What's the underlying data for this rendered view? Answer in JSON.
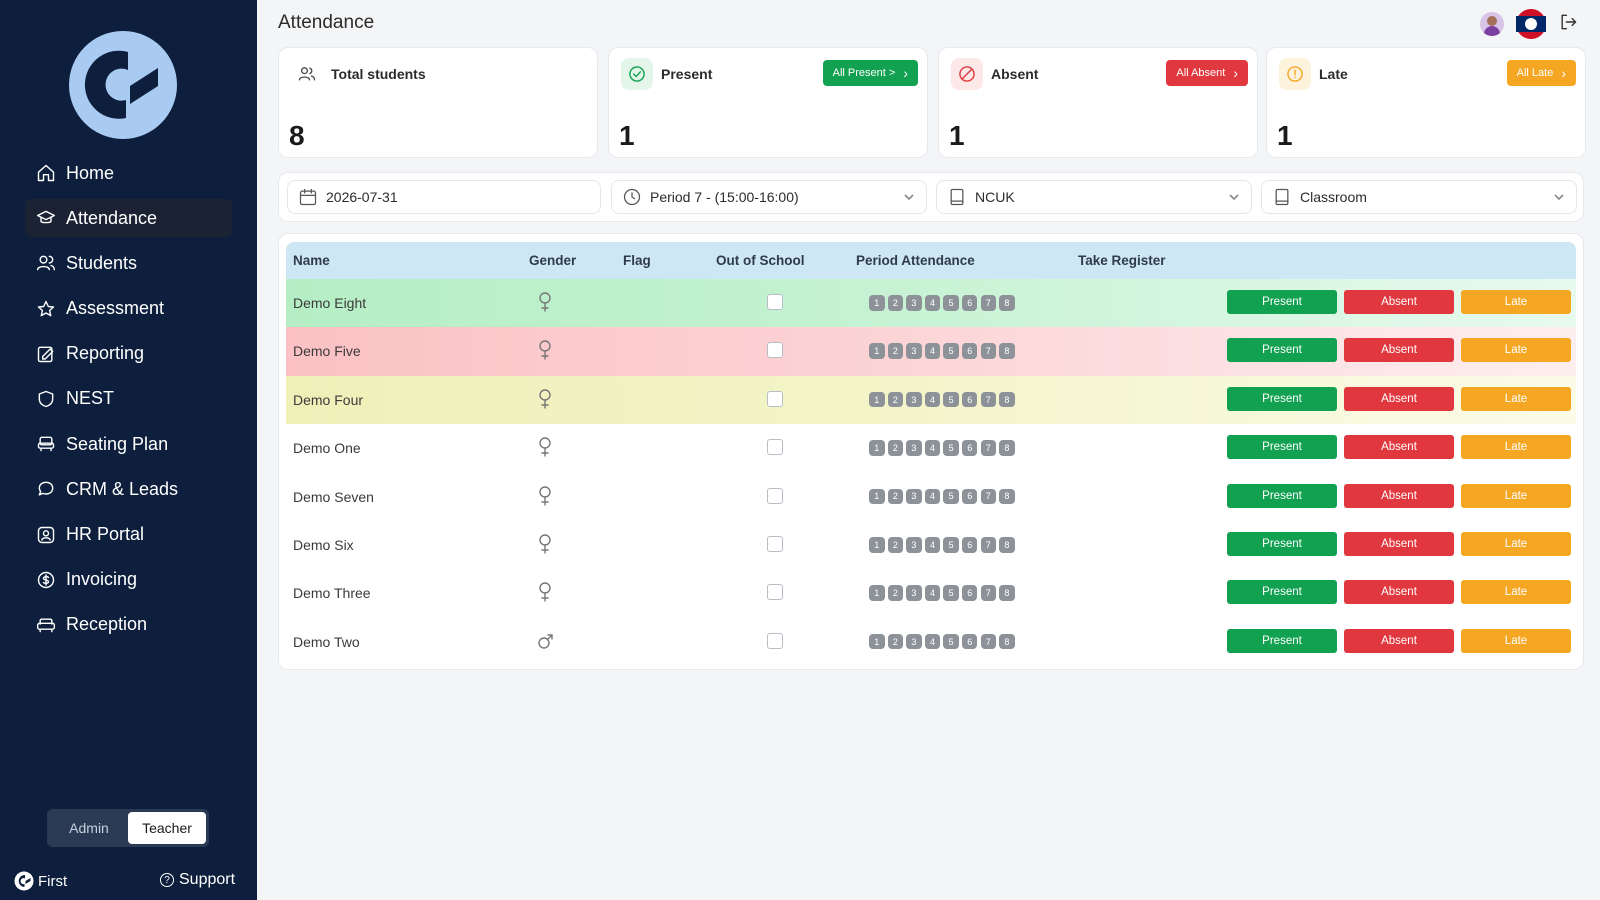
{
  "app": {
    "page_title": "Attendance"
  },
  "sidebar": {
    "items": [
      {
        "label": "Home",
        "icon": "home-icon",
        "active": false
      },
      {
        "label": "Attendance",
        "icon": "graduation-cap-icon",
        "active": true
      },
      {
        "label": "Students",
        "icon": "users-icon",
        "active": false
      },
      {
        "label": "Assessment",
        "icon": "star-icon",
        "active": false
      },
      {
        "label": "Reporting",
        "icon": "edit-report-icon",
        "active": false
      },
      {
        "label": "NEST",
        "icon": "shield-icon",
        "active": false
      },
      {
        "label": "Seating Plan",
        "icon": "armchair-icon",
        "active": false
      },
      {
        "label": "CRM & Leads",
        "icon": "chat-bubble-icon",
        "active": false
      },
      {
        "label": "HR Portal",
        "icon": "user-badge-icon",
        "active": false
      },
      {
        "label": "Invoicing",
        "icon": "dollar-circle-icon",
        "active": false
      },
      {
        "label": "Reception",
        "icon": "sofa-icon",
        "active": false
      }
    ],
    "role_toggle": {
      "admin": "Admin",
      "teacher": "Teacher",
      "selected": "Teacher"
    },
    "brand": "First",
    "support": "Support"
  },
  "stats": {
    "total": {
      "label": "Total students",
      "value": "8",
      "icon": "users-icon"
    },
    "present": {
      "label": "Present",
      "value": "1",
      "button": "All Present >",
      "icon": "check-circle-icon",
      "color": "#12a150"
    },
    "absent": {
      "label": "Absent",
      "value": "1",
      "button": "All Absent",
      "icon": "ban-icon",
      "color": "#e0383e"
    },
    "late": {
      "label": "Late",
      "value": "1",
      "button": "All Late",
      "icon": "alert-circle-icon",
      "color": "#f5a623"
    }
  },
  "filters": {
    "date": "2026-07-31",
    "period": "Period 7 - (15:00-16:00)",
    "site": "NCUK",
    "classroom": "Classroom"
  },
  "table": {
    "columns": {
      "name": "Name",
      "gender": "Gender",
      "flag": "Flag",
      "out_of_school": "Out of School",
      "period_attendance": "Period Attendance",
      "take_register": "Take Register"
    },
    "period_numbers": [
      "1",
      "2",
      "3",
      "4",
      "5",
      "6",
      "7",
      "8"
    ],
    "button_labels": {
      "present": "Present",
      "absent": "Absent",
      "late": "Late"
    },
    "rows": [
      {
        "name": "Demo Eight",
        "gender": "female",
        "status": "present"
      },
      {
        "name": "Demo Five",
        "gender": "female",
        "status": "absent"
      },
      {
        "name": "Demo Four",
        "gender": "female",
        "status": "late"
      },
      {
        "name": "Demo One",
        "gender": "female",
        "status": "none"
      },
      {
        "name": "Demo Seven",
        "gender": "female",
        "status": "none"
      },
      {
        "name": "Demo Six",
        "gender": "female",
        "status": "none"
      },
      {
        "name": "Demo Three",
        "gender": "female",
        "status": "none"
      },
      {
        "name": "Demo Two",
        "gender": "male",
        "status": "none"
      }
    ]
  },
  "colors": {
    "sidebar_bg": "#0d1f3c",
    "present": "#12a150",
    "absent": "#e0383e",
    "late": "#f5a623",
    "table_header": "#cde7f5"
  }
}
